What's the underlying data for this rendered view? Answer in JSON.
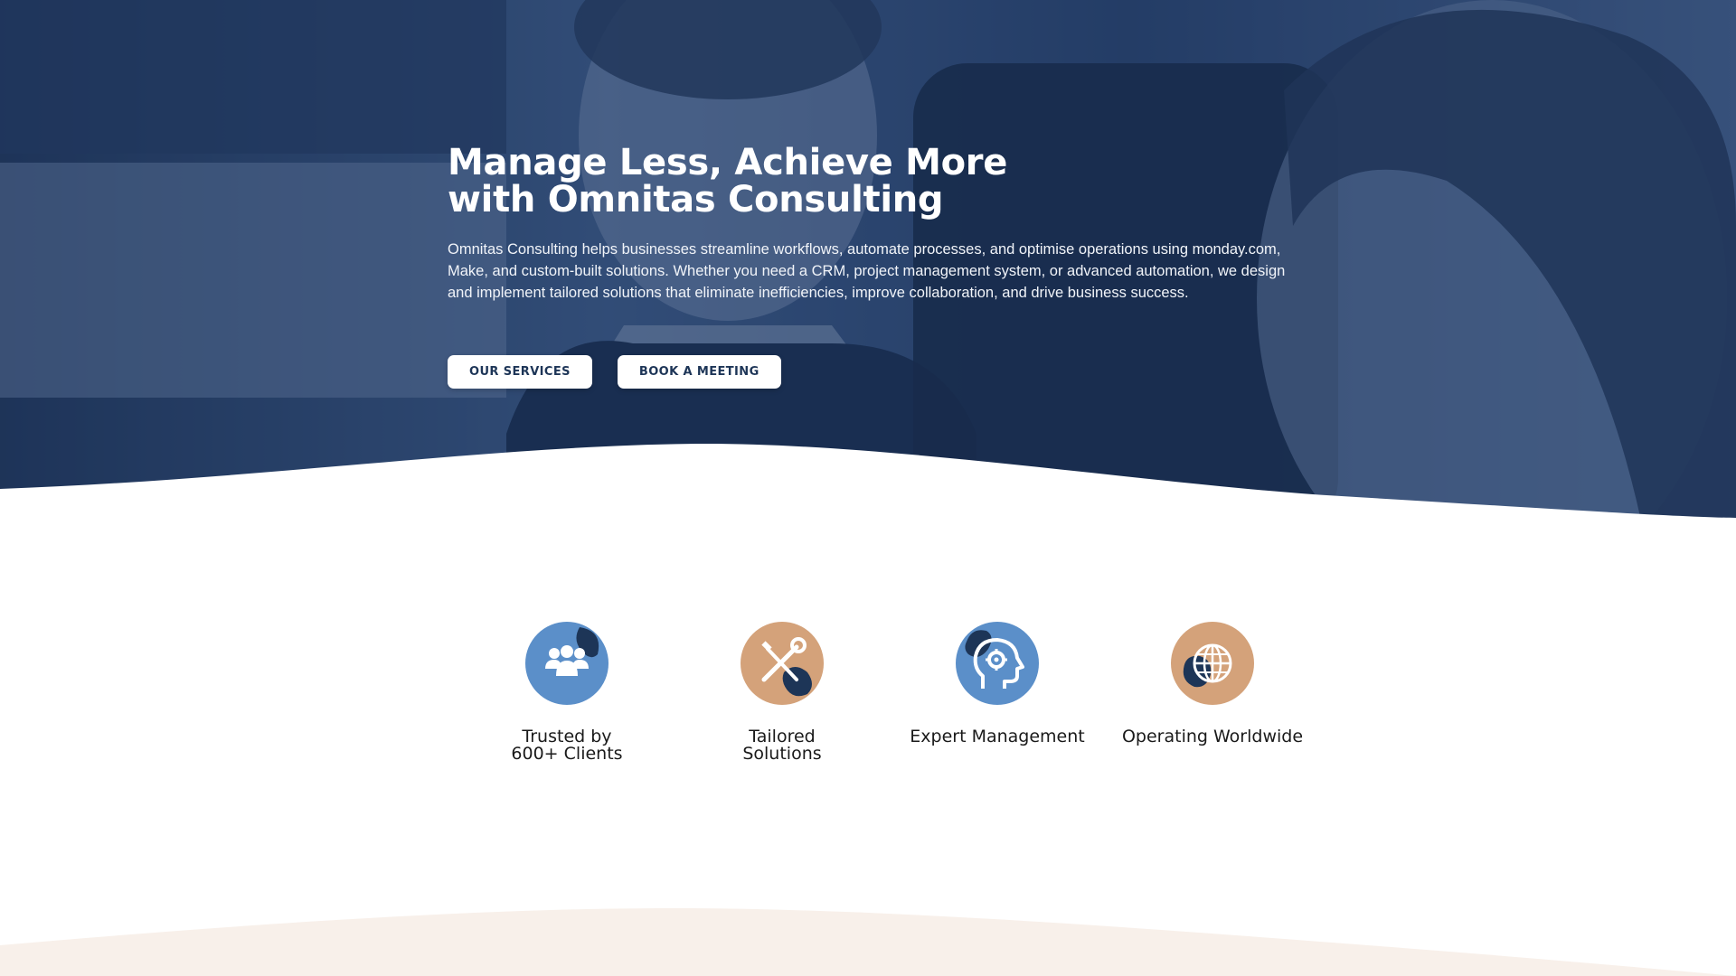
{
  "hero": {
    "title_line1": "Manage Less, Achieve More",
    "title_line2": "with Omnitas Consulting",
    "description": "Omnitas Consulting helps businesses streamline workflows, automate processes, and optimise operations using monday.com, Make, and custom-built solutions. Whether you need a CRM, project management system, or advanced automation, we design and implement tailored solutions that eliminate inefficiencies, improve collaboration, and drive business success.",
    "buttons": {
      "services_label": "OUR SERVICES",
      "meeting_label": "BOOK A MEETING"
    }
  },
  "features": [
    {
      "label": "Trusted by\n600+ Clients",
      "icon": "people-group-icon",
      "color": "#5b8fc9"
    },
    {
      "label": "Tailored\nSolutions",
      "icon": "tools-icon",
      "color": "#d4a27a"
    },
    {
      "label": "Expert Management",
      "icon": "head-gear-icon",
      "color": "#5b8fc9"
    },
    {
      "label": "Operating Worldwide",
      "icon": "globe-icon",
      "color": "#d4a27a"
    }
  ],
  "colors": {
    "navy": "#1d3557",
    "blue": "#5b8fc9",
    "tan": "#d4a27a",
    "cream": "#f8f0ea"
  }
}
